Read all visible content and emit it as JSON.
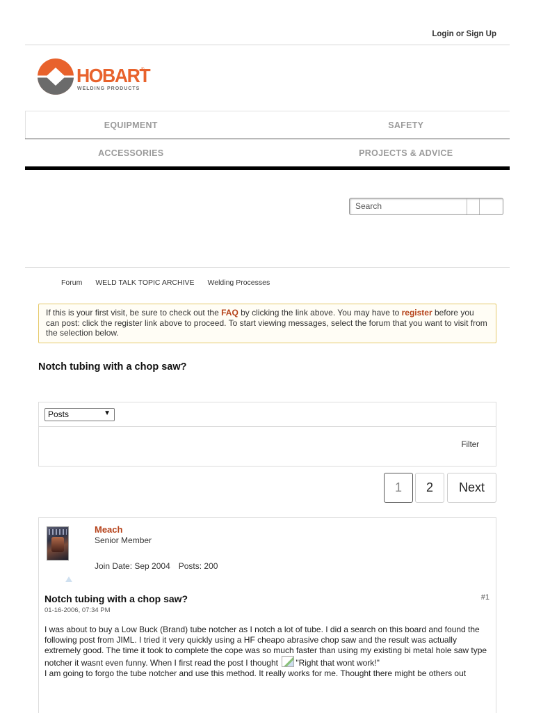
{
  "header": {
    "login_label": "Login or Sign Up"
  },
  "logo": {
    "brand": "HOBART",
    "registered": "®",
    "tagline": "WELDING PRODUCTS",
    "colors": {
      "orange": "#e8622c",
      "gray": "#6b6b6b"
    }
  },
  "nav": {
    "items": [
      {
        "label": "EQUIPMENT"
      },
      {
        "label": "SAFETY"
      },
      {
        "label": "ACCESSORIES"
      },
      {
        "label": "PROJECTS & ADVICE"
      }
    ]
  },
  "search": {
    "placeholder": "Search"
  },
  "breadcrumbs": [
    {
      "label": "Forum"
    },
    {
      "label": "WELD TALK TOPIC ARCHIVE"
    },
    {
      "label": "Welding Processes"
    }
  ],
  "notice": {
    "part1": "If this is your first visit, be sure to check out the ",
    "faq": "FAQ",
    "part2": " by clicking the link above. You may have to ",
    "register": "register",
    "part3": " before you can post: click the register link above to proceed. To start viewing messages, select the forum that you want to visit from the selection below."
  },
  "thread": {
    "title": "Notch tubing with a chop saw?"
  },
  "filter": {
    "select_value": "Posts",
    "filter_label": "Filter"
  },
  "pagination": {
    "page1": "1",
    "page2": "2",
    "next": "Next"
  },
  "post": {
    "author": "Meach",
    "rank": "Senior Member",
    "join_date": "Join Date: Sep 2004",
    "posts": "Posts: 200",
    "title": "Notch tubing with a chop saw?",
    "number": "#1",
    "date": "01-16-2006, 07:34 PM",
    "body_p1": "I was about to buy a Low Buck (Brand) tube notcher as I notch a lot of tube. I did a search on this board and found the following post from JIML. I tried it very quickly using a HF cheapo abrasive chop saw and the result was actually extremely good. The time it took to complete the cope was so much faster than using my existing bi metal hole saw type notcher it wasnt even funny. When I first read the post I thought",
    "body_quote": "\"Right that wont work!\"",
    "body_p2": "I am going to forgo the tube notcher and use this method. It really works for me. Thought there might be others out"
  }
}
